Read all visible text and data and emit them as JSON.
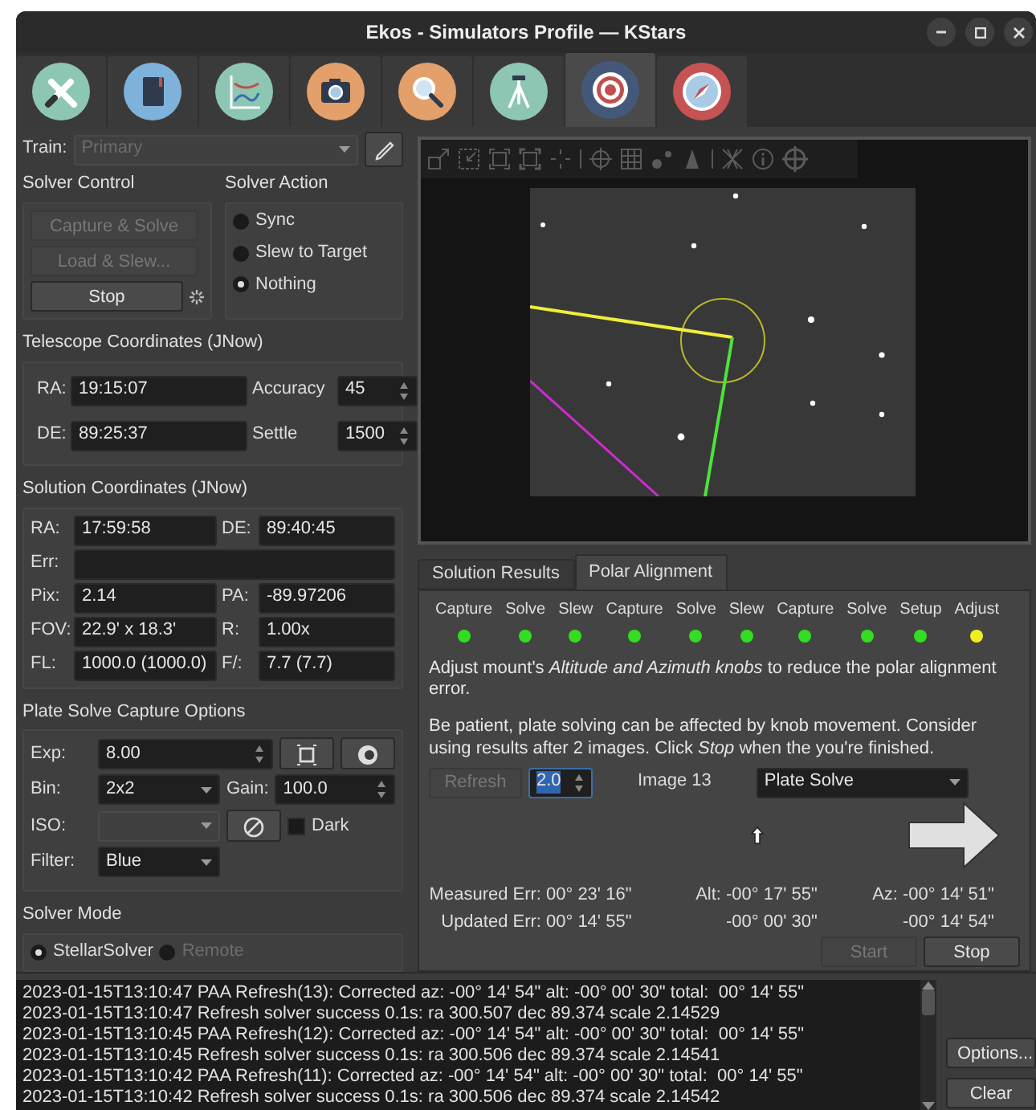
{
  "window": {
    "title": "Ekos - Simulators Profile — KStars"
  },
  "module_tabs": [
    {
      "selected": false
    },
    {
      "selected": false
    },
    {
      "selected": false
    },
    {
      "selected": false
    },
    {
      "selected": false
    },
    {
      "selected": false
    },
    {
      "selected": true
    },
    {
      "selected": false
    }
  ],
  "train": {
    "label": "Train:",
    "value": "Primary",
    "disabled": true
  },
  "solver_control": {
    "title": "Solver Control",
    "buttons": [
      {
        "label": "Capture & Solve",
        "disabled": true
      },
      {
        "label": "Load & Slew...",
        "disabled": true
      },
      {
        "label": "Stop",
        "disabled": false
      }
    ]
  },
  "solver_action": {
    "title": "Solver Action",
    "options": [
      {
        "label": "Sync",
        "selected": false
      },
      {
        "label": "Slew to Target",
        "selected": false
      },
      {
        "label": "Nothing",
        "selected": true
      }
    ]
  },
  "telescope_coordinates": {
    "title": "Telescope Coordinates (JNow)",
    "fields": [
      {
        "label": "RA:",
        "value": "19:15:07"
      },
      {
        "label": "Accuracy",
        "value": "45"
      },
      {
        "label": "DE:",
        "value": "89:25:37"
      },
      {
        "label": "Settle",
        "value": "1500"
      }
    ]
  },
  "solution_coordinates": {
    "title": "Solution Coordinates (JNow)",
    "fields": [
      {
        "label": "RA:",
        "value": "17:59:58"
      },
      {
        "label": "DE:",
        "value": "89:40:45"
      },
      {
        "label": "Err:"
      },
      {
        "label": "Pix:",
        "value": "2.14"
      },
      {
        "label": "PA:",
        "value": "-89.97206"
      },
      {
        "label": "FOV:",
        "value": "22.9' x 18.3'"
      },
      {
        "label": "R:",
        "value": "1.00x"
      },
      {
        "label": "FL:",
        "value": "1000.0 (1000.0)"
      },
      {
        "label": "F/:",
        "value": "7.7 (7.7)"
      }
    ]
  },
  "capture_options": {
    "title": "Plate Solve Capture Options",
    "exposure": {
      "label": "Exp:",
      "value": "8.00"
    },
    "binning": {
      "label": "Bin:",
      "value": "2x2"
    },
    "gain": {
      "label": "Gain:",
      "value": "100.0"
    },
    "iso": {
      "label": "ISO:",
      "disabled": true
    },
    "dark": {
      "label": "Dark",
      "checked": false
    },
    "filter": {
      "label": "Filter:",
      "value": "Blue"
    }
  },
  "solver_mode": {
    "title": "Solver Mode",
    "options": [
      {
        "label": "StellarSolver",
        "selected": true,
        "disabled": false
      },
      {
        "label": "Remote",
        "selected": false,
        "disabled": true
      }
    ]
  },
  "result_tabs": [
    {
      "label": "Solution Results",
      "selected": false
    },
    {
      "label": "Polar Alignment",
      "selected": true
    }
  ],
  "stages": [
    {
      "label": "Capture",
      "color": "#33dd22"
    },
    {
      "label": "Solve",
      "color": "#33dd22"
    },
    {
      "label": "Slew",
      "color": "#33dd22"
    },
    {
      "label": "Capture",
      "color": "#33dd22"
    },
    {
      "label": "Solve",
      "color": "#33dd22"
    },
    {
      "label": "Slew",
      "color": "#33dd22"
    },
    {
      "label": "Capture",
      "color": "#33dd22"
    },
    {
      "label": "Solve",
      "color": "#33dd22"
    },
    {
      "label": "Setup",
      "color": "#33dd22"
    },
    {
      "label": "Adjust",
      "color": "#eeee22"
    }
  ],
  "instructions": [
    "Adjust mount's *Altitude and Azimuth knobs* to reduce the polar alignment error.",
    "Be patient, plate solving can be affected by knob movement. Consider using results after 2 images. Click *Stop* when the you're finished."
  ],
  "refresh": {
    "label": "Refresh",
    "disabled": true
  },
  "interval": {
    "value": "2.0"
  },
  "image_label": "Image 13",
  "method": {
    "value": "Plate Solve"
  },
  "errors": [
    {
      "label": "Measured Err:",
      "total": "00° 23' 16\"",
      "alt_label": "Alt:",
      "alt": "-00° 17' 55\"",
      "az_label": "Az:",
      "az": "-00° 14' 51\""
    },
    {
      "label": "Updated Err:",
      "total": "00° 14' 55\"",
      "alt": "-00° 00' 30\"",
      "az": "-00° 14' 54\""
    }
  ],
  "actions": [
    {
      "label": "Start",
      "disabled": true
    },
    {
      "label": "Stop",
      "disabled": false
    }
  ],
  "log": {
    "lines": [
      "2023-01-15T13:10:47 PAA Refresh(13): Corrected az: -00° 14' 54\" alt: -00° 00' 30\" total:  00° 14' 55\"",
      "2023-01-15T13:10:47 Refresh solver success 0.1s: ra 300.507 dec 89.374 scale 2.14529",
      "2023-01-15T13:10:45 PAA Refresh(12): Corrected az: -00° 14' 54\" alt: -00° 00' 30\" total:  00° 14' 55\"",
      "2023-01-15T13:10:45 Refresh solver success 0.1s: ra 300.506 dec 89.374 scale 2.14541",
      "2023-01-15T13:10:42 PAA Refresh(11): Corrected az: -00° 14' 54\" alt: -00° 00' 30\" total:  00° 14' 55\"",
      "2023-01-15T13:10:42 Refresh solver success 0.1s: ra 300.506 dec 89.374 scale 2.14542"
    ],
    "buttons": [
      "Options...",
      "Clear"
    ]
  }
}
